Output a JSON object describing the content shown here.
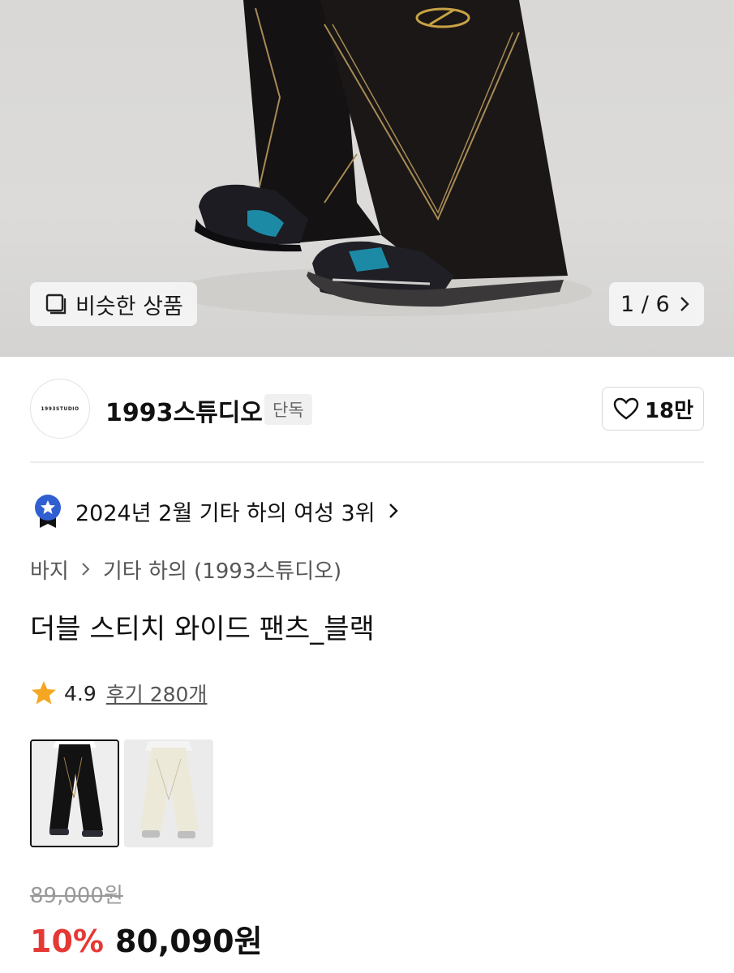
{
  "gallery": {
    "similar_label": "비슷한 상품",
    "counter": "1 / 6"
  },
  "brand": {
    "logo_text": "1993STUDIO",
    "name": "1993스튜디오",
    "badge": "단독",
    "likes": "18만"
  },
  "ranking": {
    "text": "2024년 2월 기타 하의 여성 3위"
  },
  "breadcrumb": {
    "category": "바지",
    "subcategory": "기타 하의 (1993스튜디오)"
  },
  "product": {
    "title": "더블 스티치 와이드 팬츠_블랙",
    "rating": "4.9",
    "reviews": "후기 280개"
  },
  "price": {
    "original": "89,000원",
    "discount": "10%",
    "sale": "80,090원"
  },
  "colors": {
    "accent": "#e53935",
    "star": "#f5a623",
    "medal": "#2f5fd0"
  }
}
